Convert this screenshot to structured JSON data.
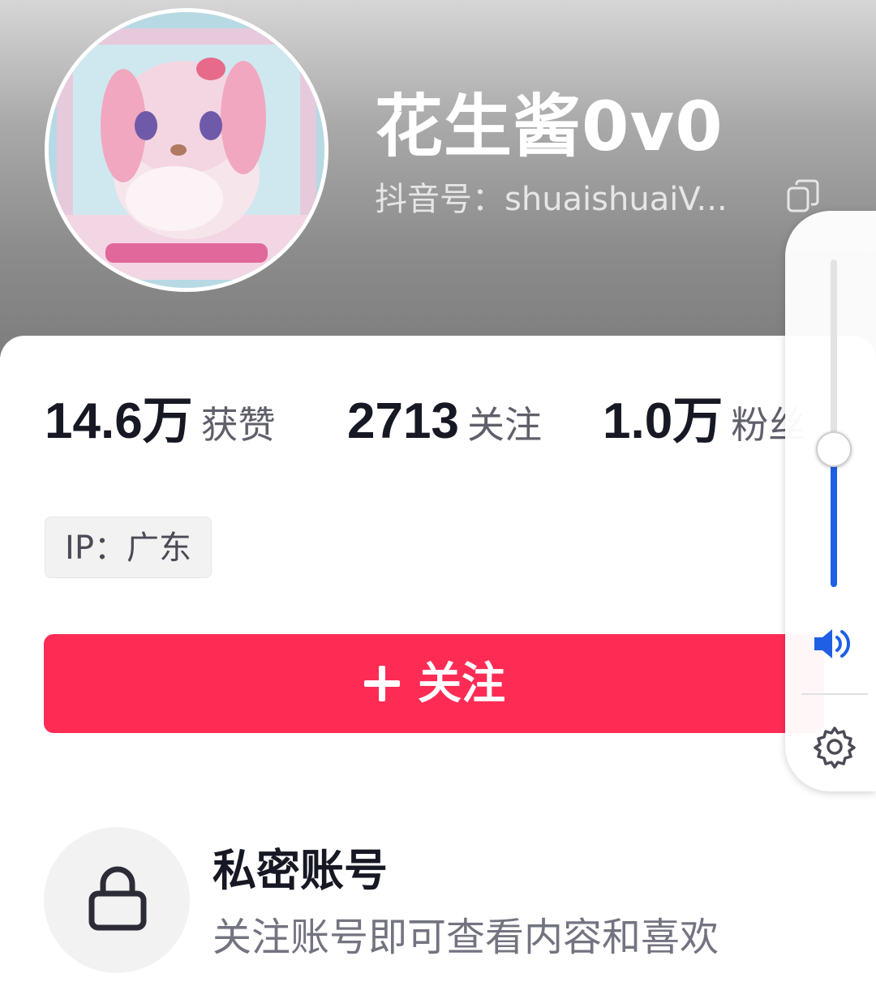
{
  "profile": {
    "name": "花生酱0v0",
    "douyin_id": "抖音号：shuaishuaiV...",
    "avatar": "plush-bunny-avatar"
  },
  "stats": [
    {
      "value": "14.6万",
      "label": "获赞"
    },
    {
      "value": "2713",
      "label": "关注"
    },
    {
      "value": "1.0万",
      "label": "粉丝"
    }
  ],
  "ip": "IP：广东",
  "follow_button": {
    "label": "关注",
    "icon": "plus-icon",
    "color": "#fe2c55"
  },
  "private": {
    "title": "私密账号",
    "subtitle": "关注账号即可查看内容和喜欢",
    "icon": "lock-icon"
  },
  "volume_panel": {
    "level": 0.42,
    "accent": "#1f5fe6",
    "icons": [
      "speaker-icon",
      "gear-icon"
    ]
  }
}
